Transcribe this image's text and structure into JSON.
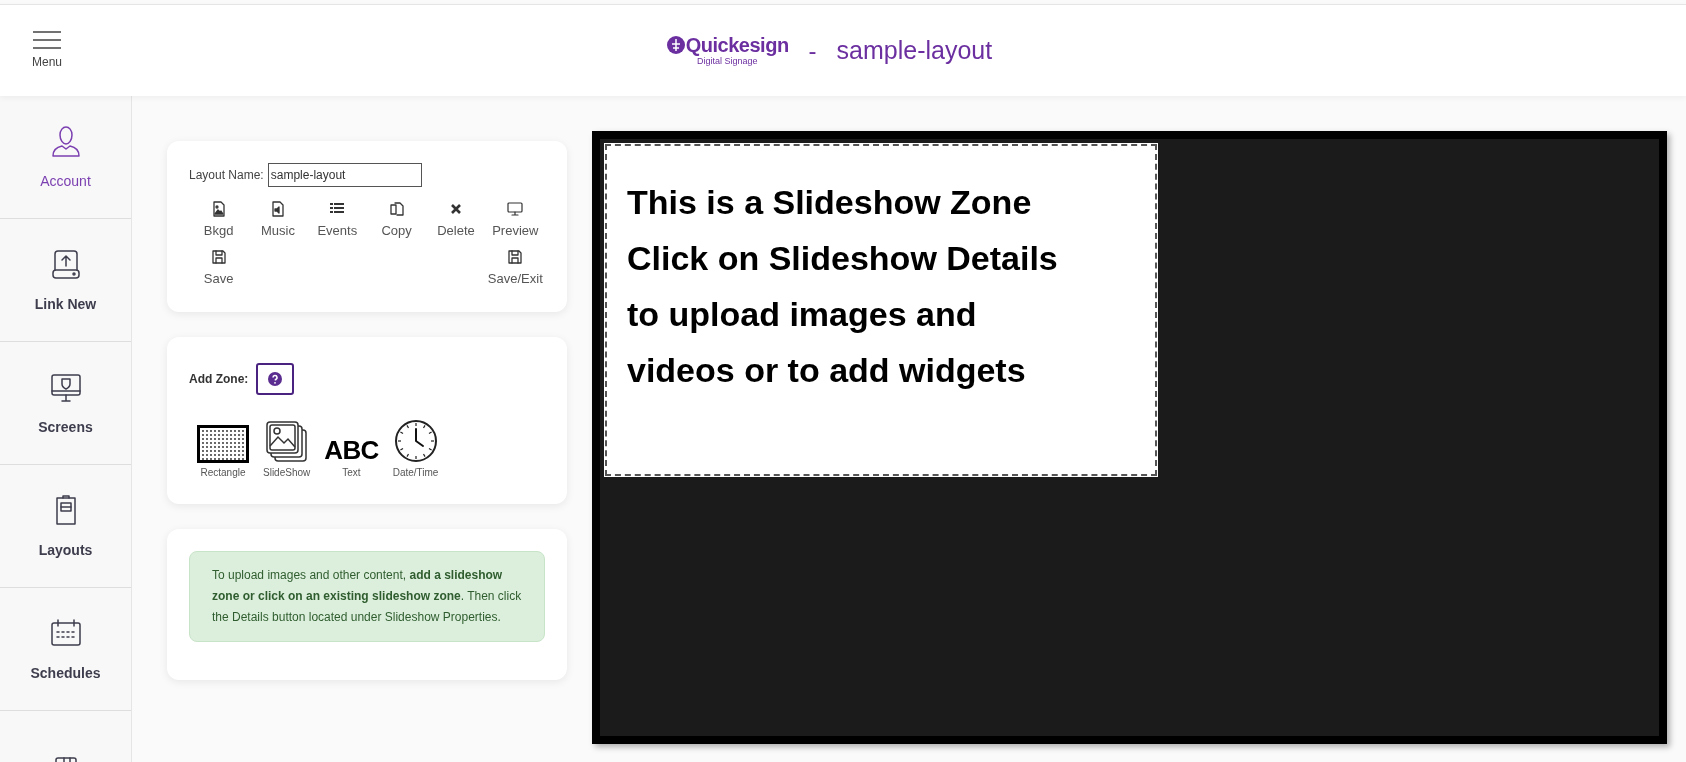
{
  "header": {
    "menu_label": "Menu",
    "brand": "Quickesign",
    "brand_tagline": "Digital Signage",
    "separator": "-",
    "layout_title": "sample-layout"
  },
  "sidebar": {
    "items": [
      {
        "label": "Account",
        "selected": true
      },
      {
        "label": "Link New",
        "selected": false
      },
      {
        "label": "Screens",
        "selected": false
      },
      {
        "label": "Layouts",
        "selected": false
      },
      {
        "label": "Schedules",
        "selected": false
      },
      {
        "selected": false
      }
    ]
  },
  "layout_card": {
    "name_label": "Layout Name:",
    "name_value": "sample-layout",
    "actions": [
      {
        "label": "Bkgd",
        "kind": "image"
      },
      {
        "label": "Music",
        "kind": "music"
      },
      {
        "label": "Events",
        "kind": "list"
      },
      {
        "label": "Copy",
        "kind": "copy"
      },
      {
        "label": "Delete",
        "kind": "delete"
      },
      {
        "label": "Preview",
        "kind": "monitor"
      },
      {
        "label": "Save",
        "kind": "save"
      },
      {
        "label": "Save/Exit",
        "kind": "save"
      }
    ]
  },
  "zone_card": {
    "label": "Add Zone:",
    "zones": [
      {
        "label": "Rectangle",
        "kind": "rectangle"
      },
      {
        "label": "SlideShow",
        "kind": "slideshow"
      },
      {
        "label": "Text",
        "kind": "text",
        "glyph": "ABC"
      },
      {
        "label": "Date/Time",
        "kind": "clock"
      }
    ]
  },
  "info_box": {
    "text": "To upload images and other content, **add a slideshow zone or click on an existing slideshow zone**. Then click the Details button located under Slideshow Properties."
  },
  "canvas": {
    "zones": [
      {
        "lines": [
          "This is a Slideshow Zone",
          "Click on Slideshow Details",
          "to upload images and",
          "videos or to add widgets"
        ]
      }
    ]
  }
}
